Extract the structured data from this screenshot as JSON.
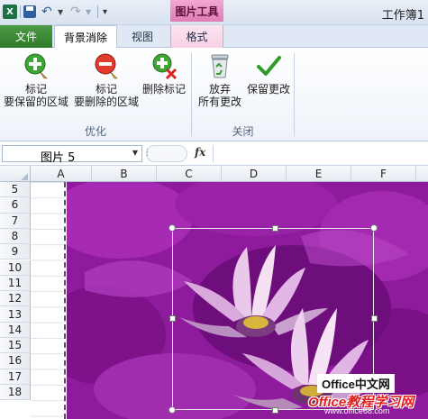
{
  "titlebar": {
    "app_icon": "excel-icon",
    "context_group": "图片工具",
    "doc_title": "工作簿1"
  },
  "tabs": {
    "file": "文件",
    "background_removal": "背景消除",
    "view": "视图",
    "format": "格式"
  },
  "ribbon": {
    "buttons": {
      "mark_keep": {
        "line1": "标记",
        "line2": "要保留的区域"
      },
      "mark_remove": {
        "line1": "标记",
        "line2": "要删除的区域"
      },
      "delete_mark": {
        "line1": "删除标记"
      },
      "discard": {
        "line1": "放弃",
        "line2": "所有更改"
      },
      "keep": {
        "line1": "保留更改"
      }
    },
    "groups": {
      "refine": "优化",
      "close": "关闭"
    }
  },
  "formula_bar": {
    "name_box": "图片 5",
    "fx": "fx",
    "formula": ""
  },
  "sheet": {
    "columns": [
      "A",
      "B",
      "C",
      "D",
      "E",
      "F"
    ],
    "rows": [
      "5",
      "6",
      "7",
      "8",
      "9",
      "10",
      "11",
      "12",
      "13",
      "14",
      "15",
      "16",
      "17",
      "18"
    ]
  },
  "watermark": {
    "brand": "Office中文网",
    "title": "Office教程学习网",
    "url": "www.office68.com"
  },
  "colors": {
    "file_tab": "#2f7b2c",
    "context_header": "#e27bb6",
    "background_mark": "#8e1a9c"
  }
}
